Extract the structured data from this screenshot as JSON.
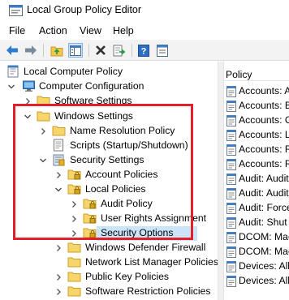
{
  "window": {
    "title": "Local Group Policy Editor"
  },
  "menu": [
    {
      "label": "File"
    },
    {
      "label": "Action"
    },
    {
      "label": "View"
    },
    {
      "label": "Help"
    }
  ],
  "toolbar": {
    "buttons": [
      "back-icon",
      "forward-icon",
      "up-folder-icon",
      "show-hide-tree-icon",
      "delete-icon",
      "export-list-icon",
      "help-icon",
      "properties-icon"
    ]
  },
  "tree": {
    "root": "Local Computer Policy",
    "computer_configuration": "Computer Configuration",
    "software_settings": "Software Settings",
    "windows_settings": "Windows Settings",
    "name_resolution_policy": "Name Resolution Policy",
    "scripts": "Scripts (Startup/Shutdown)",
    "security_settings": "Security Settings",
    "account_policies": "Account Policies",
    "local_policies": "Local Policies",
    "audit_policy": "Audit Policy",
    "user_rights_assignment": "User Rights Assignment",
    "security_options": "Security Options",
    "windows_defender_firewall": "Windows Defender Firewall",
    "network_list_manager": "Network List Manager Policies",
    "public_key_policies": "Public Key Policies",
    "software_restriction": "Software Restriction Policies"
  },
  "list": {
    "header": "Policy",
    "items": [
      "Accounts: A",
      "Accounts: B",
      "Accounts: G",
      "Accounts: L",
      "Accounts: R",
      "Accounts: R",
      "Audit: Audit",
      "Audit: Audit",
      "Audit: Force",
      "Audit: Shut",
      "DCOM: Mac",
      "DCOM: Mac",
      "Devices: All",
      "Devices: All"
    ]
  },
  "colors": {
    "highlight_border": "#e0202a",
    "selection": "#cce4f7",
    "folder": "#f2c94c"
  }
}
